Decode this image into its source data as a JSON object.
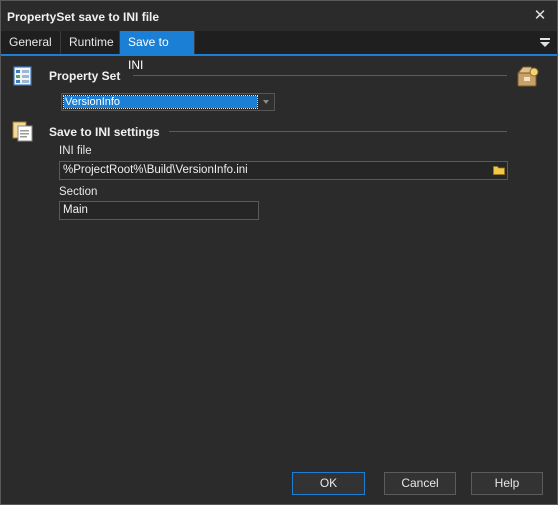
{
  "window": {
    "title": "PropertySet save to INI file"
  },
  "tabs": [
    {
      "label": "General",
      "active": false
    },
    {
      "label": "Runtime",
      "active": false
    },
    {
      "label": "Save to INI",
      "active": true
    }
  ],
  "property_set": {
    "heading": "Property Set",
    "selected": "VersionInfo"
  },
  "ini_settings": {
    "heading": "Save to INI settings",
    "ini_file_label": "INI file",
    "ini_file_value": "%ProjectRoot%\\Build\\VersionInfo.ini",
    "section_label": "Section",
    "section_value": "Main"
  },
  "buttons": {
    "ok": "OK",
    "cancel": "Cancel",
    "help": "Help"
  },
  "colors": {
    "accent": "#1c7fd6",
    "background": "#2b2b2b"
  }
}
